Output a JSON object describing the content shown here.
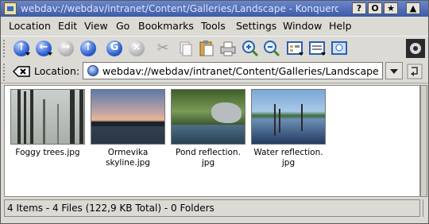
{
  "window": {
    "title": "webdav://webdav/intranet/Content/Galleries/Landscape - Konqueror",
    "buttons": [
      "?",
      "O",
      "★",
      "▲"
    ]
  },
  "menubar": {
    "items": [
      "Location",
      "Edit",
      "View",
      "Go",
      "Bookmarks",
      "Tools",
      "Settings",
      "Window",
      "Help"
    ]
  },
  "toolbar": {
    "buttons": [
      {
        "name": "back-icon"
      },
      {
        "name": "forward-icon"
      },
      {
        "name": "reload-icon"
      },
      {
        "name": "home-icon"
      },
      {
        "name": "search-icon"
      },
      {
        "name": "stop-icon"
      },
      {
        "name": "cut-icon"
      },
      {
        "name": "copy-icon"
      },
      {
        "name": "paste-icon"
      },
      {
        "name": "print-icon"
      },
      {
        "name": "zoom-in-icon"
      },
      {
        "name": "zoom-out-icon"
      },
      {
        "name": "view-mode-icon"
      },
      {
        "name": "view-list-icon"
      },
      {
        "name": "preview-icon"
      },
      {
        "name": "konqueror-gear-icon"
      }
    ]
  },
  "location": {
    "label": "Location:",
    "value": "webdav://webdav/intranet/Content/Galleries/Landscape"
  },
  "files": [
    {
      "name": "Foggy trees.jpg"
    },
    {
      "name": "Ormevika skyline.jpg"
    },
    {
      "name": "Pond reflection. jpg"
    },
    {
      "name": "Water reflection. jpg"
    }
  ],
  "statusbar": {
    "text": "4 Items - 4 Files (122,9 KB Total) - 0 Folders"
  }
}
